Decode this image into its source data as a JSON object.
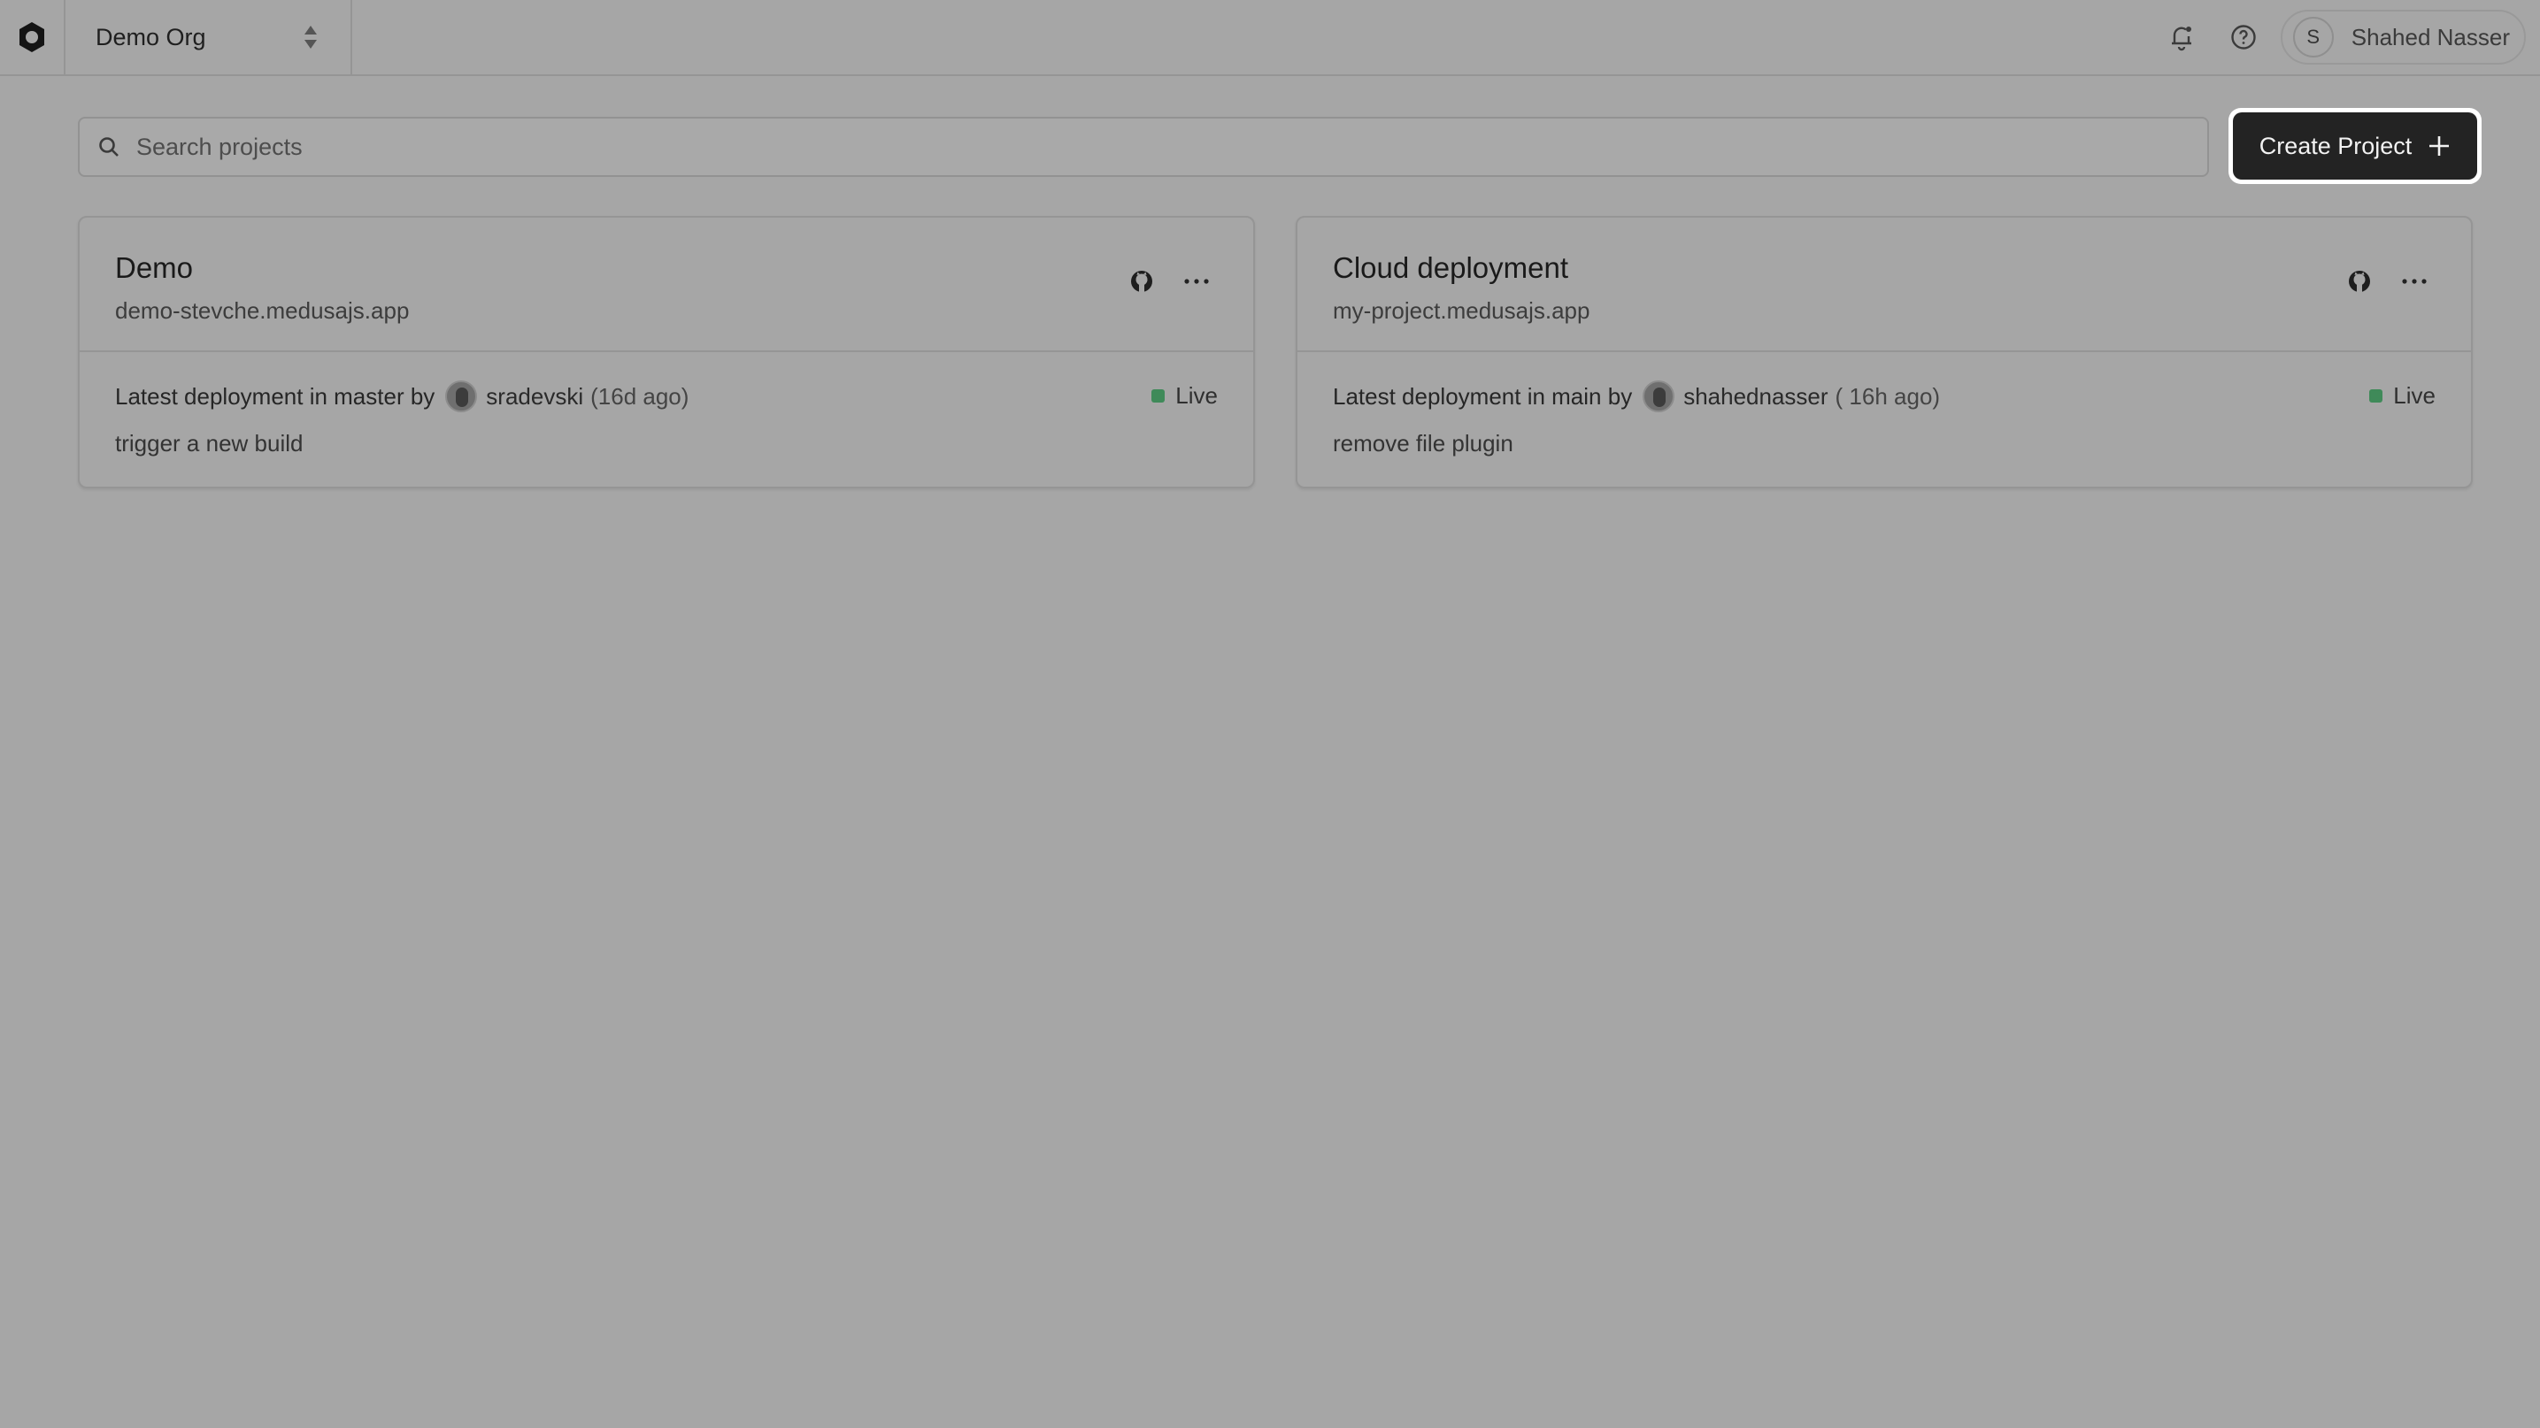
{
  "topbar": {
    "org_name": "Demo Org",
    "icons": {
      "logo": "medusa-logo-icon",
      "switcher": "sort-arrows-icon",
      "notifications": "bell-icon",
      "help": "help-circle-icon"
    },
    "user": {
      "initial": "S",
      "name": "Shahed Nasser"
    }
  },
  "search": {
    "placeholder": "Search projects",
    "value": ""
  },
  "create_button": {
    "label": "Create Project"
  },
  "projects": [
    {
      "title": "Demo",
      "url": "demo-stevche.medusajs.app",
      "deploy_prefix": "Latest deployment in master by",
      "user": "sradevski",
      "ago": "(16d ago)",
      "commit": "trigger a new build",
      "status": "Live"
    },
    {
      "title": "Cloud deployment",
      "url": "my-project.medusajs.app",
      "deploy_prefix": "Latest deployment in main by",
      "user": "shahednasser",
      "ago": "( 16h ago)",
      "commit": "remove file plugin",
      "status": "Live"
    }
  ],
  "colors": {
    "background": "#a6a6a6",
    "button": "#232323",
    "live": "#3f8a59"
  }
}
